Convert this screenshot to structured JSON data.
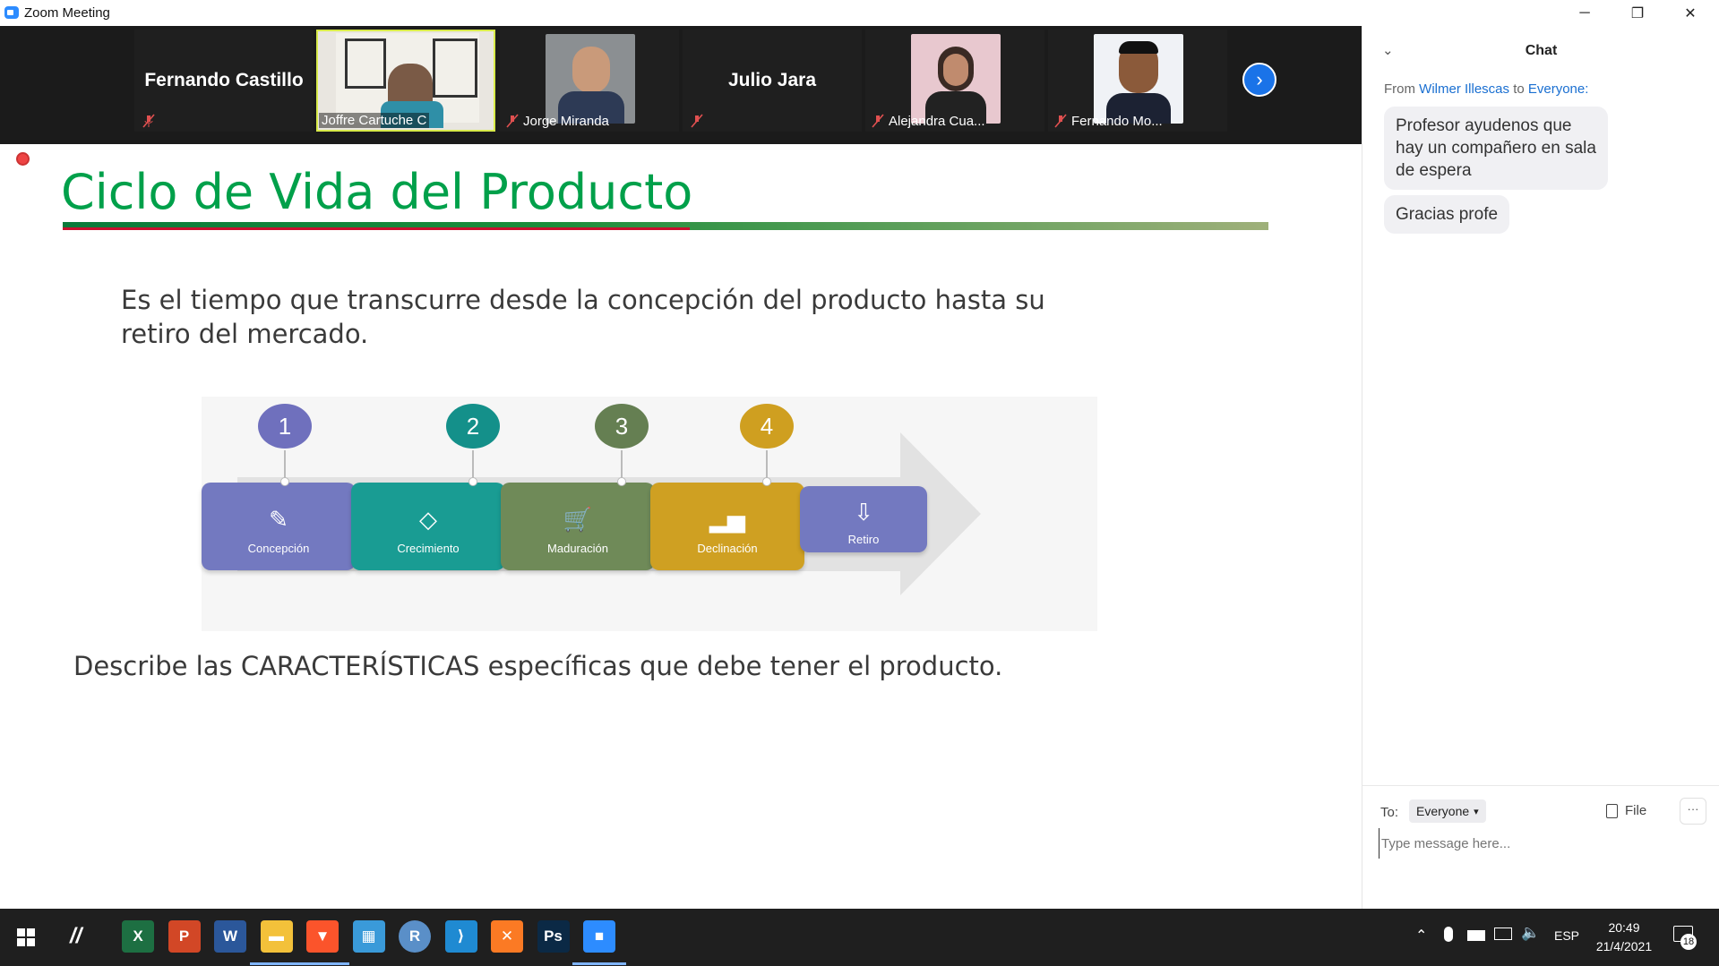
{
  "window": {
    "title": "Zoom Meeting"
  },
  "participants": [
    {
      "name": "Fernando Castillo",
      "video": false,
      "muted": true
    },
    {
      "name": "Joffre Cartuche C",
      "video": true,
      "muted": false,
      "active_speaker": true
    },
    {
      "name": "Jorge Miranda",
      "video": true,
      "muted": true
    },
    {
      "name": "Julio Jara",
      "video": false,
      "muted": true
    },
    {
      "name": "Alejandra Cua...",
      "video": true,
      "muted": true
    },
    {
      "name": "Fernando Mo...",
      "video": true,
      "muted": true
    }
  ],
  "slide": {
    "title": "Ciclo de Vida del Producto",
    "paragraph_line1": "Es el tiempo que transcurre desde la concepción del producto hasta su",
    "paragraph_line2": "retiro del mercado.",
    "footer_text": "Describe las CARACTERÍSTICAS específicas que debe tener el producto.",
    "stages": [
      {
        "number": "1",
        "label": "Concepción",
        "icon": "pencil-icon",
        "color": "#7379c0",
        "num_color": "#6f70bd"
      },
      {
        "number": "2",
        "label": "Crecimiento",
        "icon": "shapes-icon",
        "color": "#199c93",
        "num_color": "#14908a"
      },
      {
        "number": "3",
        "label": "Maduración",
        "icon": "cart-icon",
        "color": "#6f8a58",
        "num_color": "#657f52"
      },
      {
        "number": "4",
        "label": "Declinación",
        "icon": "chart-icon",
        "color": "#cfa022",
        "num_color": "#cf9f20"
      },
      {
        "number": "",
        "label": "Retiro",
        "icon": "download-icon",
        "color": "#7379c0",
        "num_color": ""
      }
    ]
  },
  "chat": {
    "header": "Chat",
    "from_prefix": "From",
    "sender": "Wilmer Illescas",
    "to_word": "to",
    "recipient": "Everyone:",
    "messages": [
      "Profesor ayudenos que hay un compañero en sala de espera",
      "Gracias profe"
    ],
    "to_label": "To:",
    "to_select": "Everyone",
    "file_label": "File",
    "more_label": "···",
    "input_placeholder": "Type message here..."
  },
  "taskbar": {
    "apps": [
      {
        "name": "excel",
        "glyph": "X",
        "color": "#1d6f42"
      },
      {
        "name": "powerpoint",
        "glyph": "P",
        "color": "#d24726"
      },
      {
        "name": "word",
        "glyph": "W",
        "color": "#2b579a"
      },
      {
        "name": "file-explorer",
        "glyph": "▬",
        "color": "#f3c13a"
      },
      {
        "name": "brave",
        "glyph": "▼",
        "color": "#fb542b"
      },
      {
        "name": "control-panel",
        "glyph": "▦",
        "color": "#3a9ad9"
      },
      {
        "name": "r",
        "glyph": "R",
        "color": "#5a8fc8"
      },
      {
        "name": "vscode",
        "glyph": "⟩",
        "color": "#1f8ad2"
      },
      {
        "name": "xampp",
        "glyph": "✕",
        "color": "#fb7a24"
      },
      {
        "name": "photoshop",
        "glyph": "Ps",
        "color": "#0b2945"
      },
      {
        "name": "zoom",
        "glyph": "■",
        "color": "#2d8cff"
      }
    ],
    "language": "ESP",
    "time": "20:49",
    "date": "21/4/2021",
    "notifications": "18"
  }
}
